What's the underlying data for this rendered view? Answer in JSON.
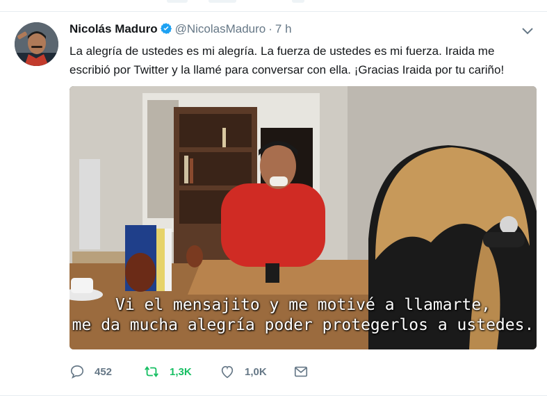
{
  "tweet": {
    "author_name": "Nicolás Maduro",
    "handle": "@NicolasMaduro",
    "separator": "·",
    "time": "7 h",
    "text_line1": "La alegría de ustedes es mi alegría. La fuerza de ustedes es mi fuerza.  Iraida me",
    "text_line2": "escribió por Twitter y la llamé para conversar con ella. ¡Gracias Iraida por tu cariño!",
    "video_subtitle_line1": "Vi el mensajito y me motivé a llamarte,",
    "video_subtitle_line2": "me da mucha alegría poder protegerlos a ustedes.",
    "replies": "452",
    "retweets": "1,3K",
    "likes": "1,0K"
  },
  "icons": {
    "avatar": "avatar-icon",
    "verified": "verified-badge-icon",
    "caret": "chevron-down-icon",
    "reply": "reply-icon",
    "retweet": "retweet-icon",
    "like": "heart-icon",
    "dm": "envelope-icon"
  },
  "colors": {
    "text": "#14171a",
    "secondary": "#657786",
    "verified": "#1da1f2",
    "retweet_active": "#17bf63",
    "divider": "#e6ecf0"
  }
}
